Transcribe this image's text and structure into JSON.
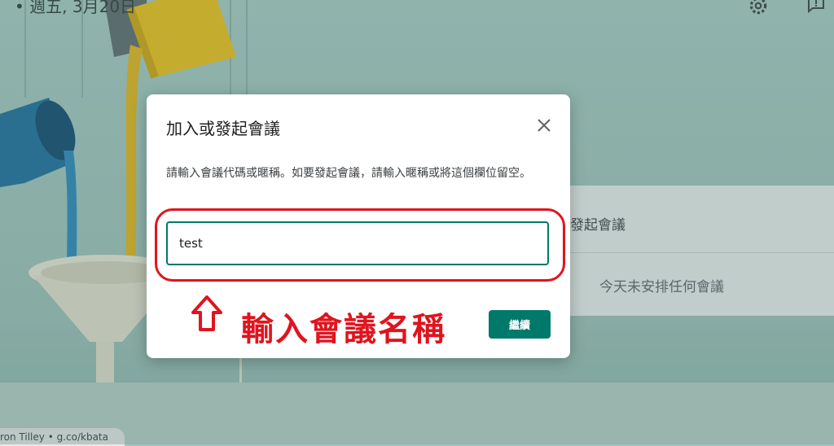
{
  "topbar": {
    "date": "• 週五, 3月20日"
  },
  "panel": {
    "start_label": "發起會議",
    "empty_label": "今天未安排任何會議"
  },
  "credit": {
    "text": "ron Tilley • g.co/kbata"
  },
  "dialog": {
    "title": "加入或發起會議",
    "description": "請輸入會議代碼或暱稱。如要發起會議，請輸入暱稱或將這個欄位留空。",
    "input_value": "test",
    "continue_label": "繼續"
  },
  "annotation": {
    "text": "輸入會議名稱",
    "color": "#e0141e"
  },
  "colors": {
    "accent": "#00796b"
  },
  "icons": [
    "gear-icon",
    "feedback-icon",
    "close-icon",
    "arrow-up-icon"
  ]
}
